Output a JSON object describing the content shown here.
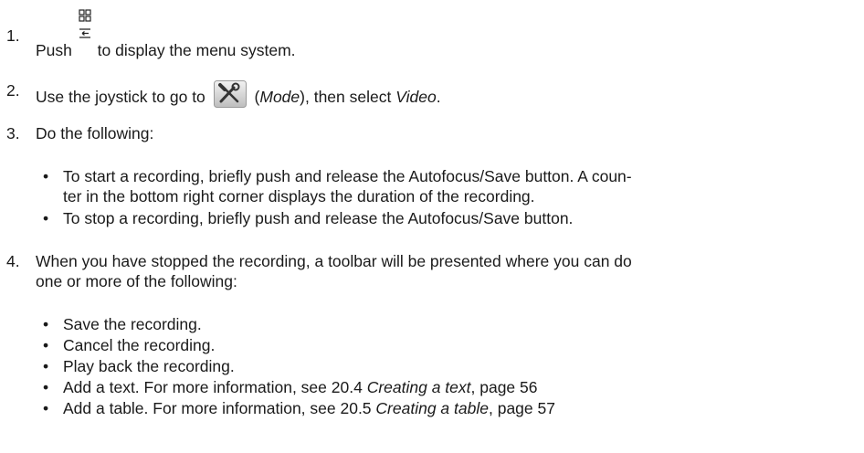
{
  "steps": [
    {
      "num": "1.",
      "pre": "Push",
      "post": "to display the menu system.",
      "icon": "menu-icon"
    },
    {
      "num": "2.",
      "pre": "Use the joystick to go to",
      "icon": "tools-icon",
      "mid1": "(",
      "mode": "Mode",
      "mid2": "), then select",
      "video": "Video",
      "end": "."
    },
    {
      "num": "3.",
      "text": "Do the following:"
    },
    {
      "num": "4.",
      "line1": "When you have stopped the recording, a toolbar will be presented where you can do",
      "line2": "one or more of the following:"
    }
  ],
  "step3_bullets": [
    {
      "line1": "To start a recording, briefly push and release the Autofocus/Save button. A coun-",
      "line2": "ter in the bottom right corner displays the duration of the recording."
    },
    {
      "line1": "To stop a recording, briefly push and release the Autofocus/Save button."
    }
  ],
  "step4_bullets": [
    {
      "text": "Save the recording."
    },
    {
      "text": "Cancel the recording."
    },
    {
      "text": "Play back the recording."
    },
    {
      "pre": "Add a text. For more information, see 20.4",
      "ref": "Creating a text",
      "post": ", page 56"
    },
    {
      "pre": "Add a table. For more information, see 20.5",
      "ref": "Creating a table",
      "post": ", page 57"
    }
  ],
  "bullet_char": "•"
}
